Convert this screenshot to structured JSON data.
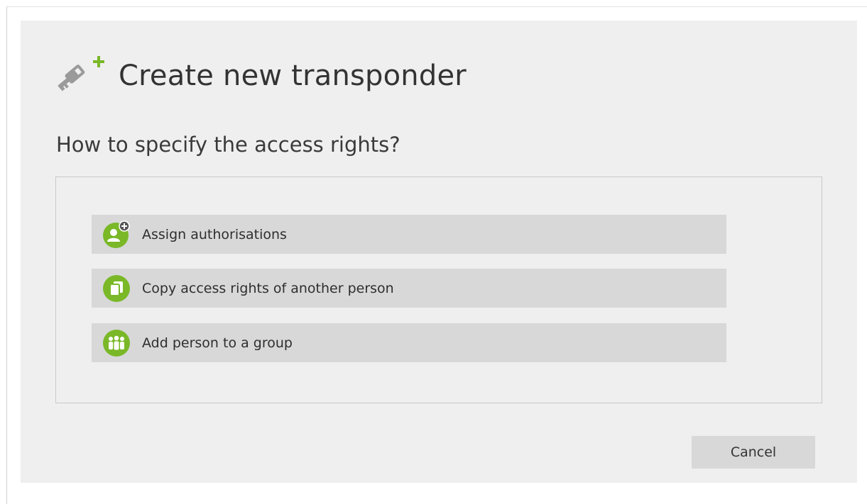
{
  "dialog": {
    "title": "Create new transponder",
    "title_icon": "key-add-icon",
    "question": "How to specify the access rights?",
    "options": [
      {
        "label": "Assign authorisations",
        "icon": "user-add-icon"
      },
      {
        "label": "Copy access rights of another person",
        "icon": "copy-icon"
      },
      {
        "label": "Add person to a group",
        "icon": "group-icon"
      }
    ],
    "cancel_label": "Cancel"
  },
  "colors": {
    "accent_green": "#7ab828",
    "icon_gray": "#9a9a9a",
    "dialog_bg": "#efefef",
    "option_bg": "#d8d8d8"
  }
}
